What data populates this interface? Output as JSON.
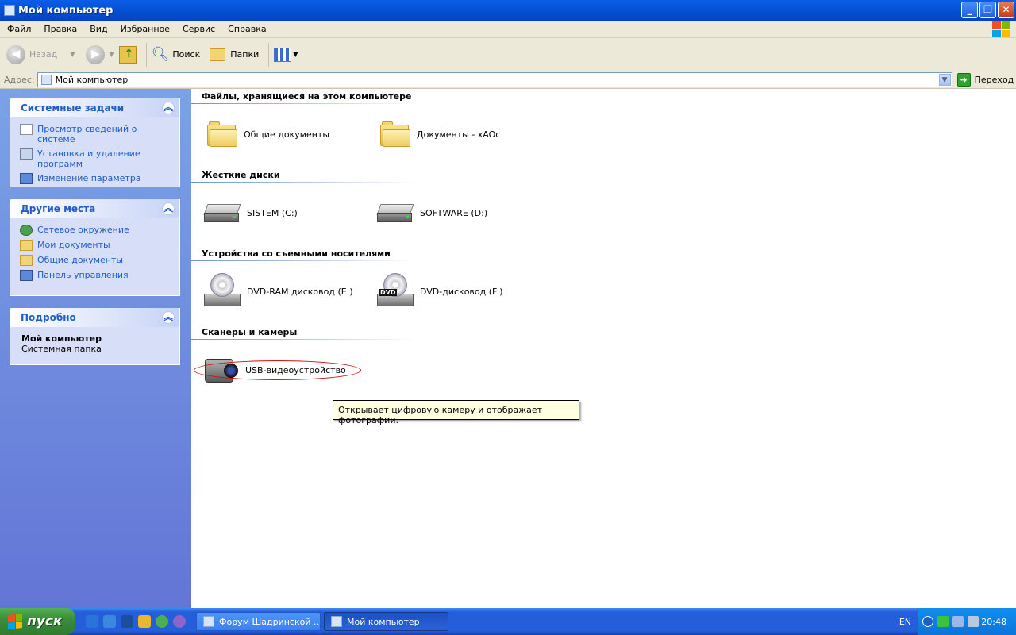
{
  "window": {
    "title": "Мой компьютер"
  },
  "menu": [
    "Файл",
    "Правка",
    "Вид",
    "Избранное",
    "Сервис",
    "Справка"
  ],
  "toolbar": {
    "back": "Назад",
    "search": "Поиск",
    "folders": "Папки"
  },
  "address": {
    "label": "Адрес:",
    "value": "Мой компьютер",
    "go": "Переход"
  },
  "left": {
    "system_tasks": {
      "title": "Системные задачи",
      "items": [
        "Просмотр сведений о системе",
        "Установка и удаление программ",
        "Изменение параметра"
      ]
    },
    "other_places": {
      "title": "Другие места",
      "items": [
        "Сетевое окружение",
        "Мои документы",
        "Общие документы",
        "Панель управления"
      ]
    },
    "details": {
      "title": "Подробно",
      "name": "Мой компьютер",
      "type": "Системная папка"
    }
  },
  "groups": {
    "files": {
      "title": "Файлы, хранящиеся на этом компьютере",
      "items": [
        "Общие документы",
        "Документы - xAOc"
      ]
    },
    "hdd": {
      "title": "Жесткие диски",
      "items": [
        "SISTEM (C:)",
        "SOFTWARE (D:)"
      ]
    },
    "removable": {
      "title": "Устройства со съемными носителями",
      "items": [
        "DVD-RAM дисковод (E:)",
        "DVD-дисковод (F:)"
      ],
      "dvd_badge": "DVD"
    },
    "scanners": {
      "title": "Сканеры и камеры",
      "items": [
        "USB-видеоустройство"
      ]
    }
  },
  "tooltip": "Открывает цифровую камеру и отображает фотографии.",
  "taskbar": {
    "start": "пуск",
    "windows": [
      "Форум Шадринской ...",
      "Мой компьютер"
    ],
    "lang": "EN",
    "clock": "20:48"
  },
  "colors": {
    "accent": "#215dc6",
    "title_blue": "#0553d6",
    "start_green": "#3c8d3c"
  }
}
